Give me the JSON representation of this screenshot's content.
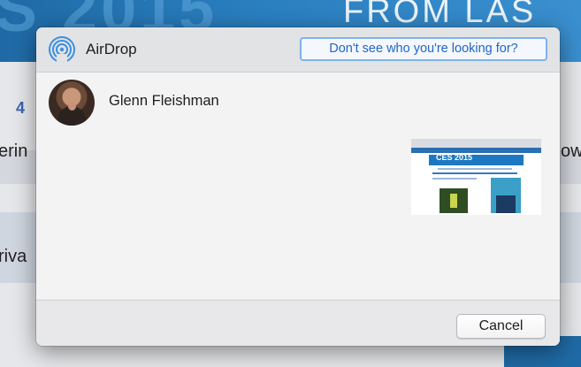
{
  "background": {
    "banner_big": "S 2015",
    "banner_right": "FROM LAS VEG",
    "number": "4",
    "fragments": [
      "erin",
      "ow.",
      "riva"
    ]
  },
  "dialog": {
    "title": "AirDrop",
    "icon": "airdrop-icon",
    "help_label": "Don't see who you're looking for?",
    "people": [
      {
        "name": "Glenn Fleishman",
        "avatar": "avatar-photo"
      }
    ],
    "thumbnail": {
      "caption": "CES 2015",
      "icon": "webpage-thumbnail"
    },
    "cancel_label": "Cancel"
  },
  "colors": {
    "link_blue": "#1e66d0",
    "airdrop_blue": "#3d8fe0",
    "banner_blue": "#1f6aa6"
  }
}
